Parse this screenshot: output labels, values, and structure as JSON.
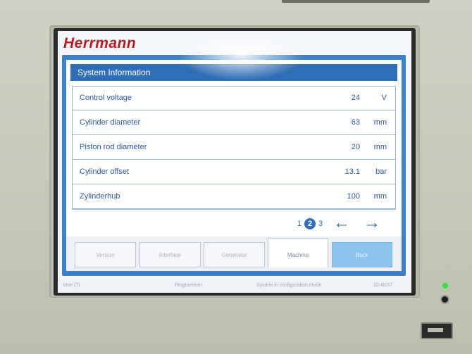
{
  "brand": "Herrmann",
  "panel": {
    "title": "System Information"
  },
  "rows": [
    {
      "label": "Control voltage",
      "value": "24",
      "unit": "V"
    },
    {
      "label": "Cylinder diameter",
      "value": "63",
      "unit": "mm"
    },
    {
      "label": "Piston rod diameter",
      "value": "20",
      "unit": "mm"
    },
    {
      "label": "Cylinder offset",
      "value": "13.1",
      "unit": "bar"
    },
    {
      "label": "Zylinderhub",
      "value": "100",
      "unit": "mm"
    }
  ],
  "pagination": {
    "pages": [
      "1",
      "2",
      "3"
    ],
    "current": "2"
  },
  "nav": {
    "prev_icon": "arrow-left-icon",
    "next_icon": "arrow-right-icon"
  },
  "tabs": {
    "version": "Version",
    "interface": "Interface",
    "generator": "Generator",
    "machine": "Machine",
    "back": "Back"
  },
  "status": {
    "left": "time (?)",
    "mode": "Programmer",
    "message": "System in configuration mode",
    "time": "10:40:57"
  },
  "colors": {
    "accent": "#2f6db6",
    "brand": "#b51d23",
    "led": "#46d84a"
  }
}
